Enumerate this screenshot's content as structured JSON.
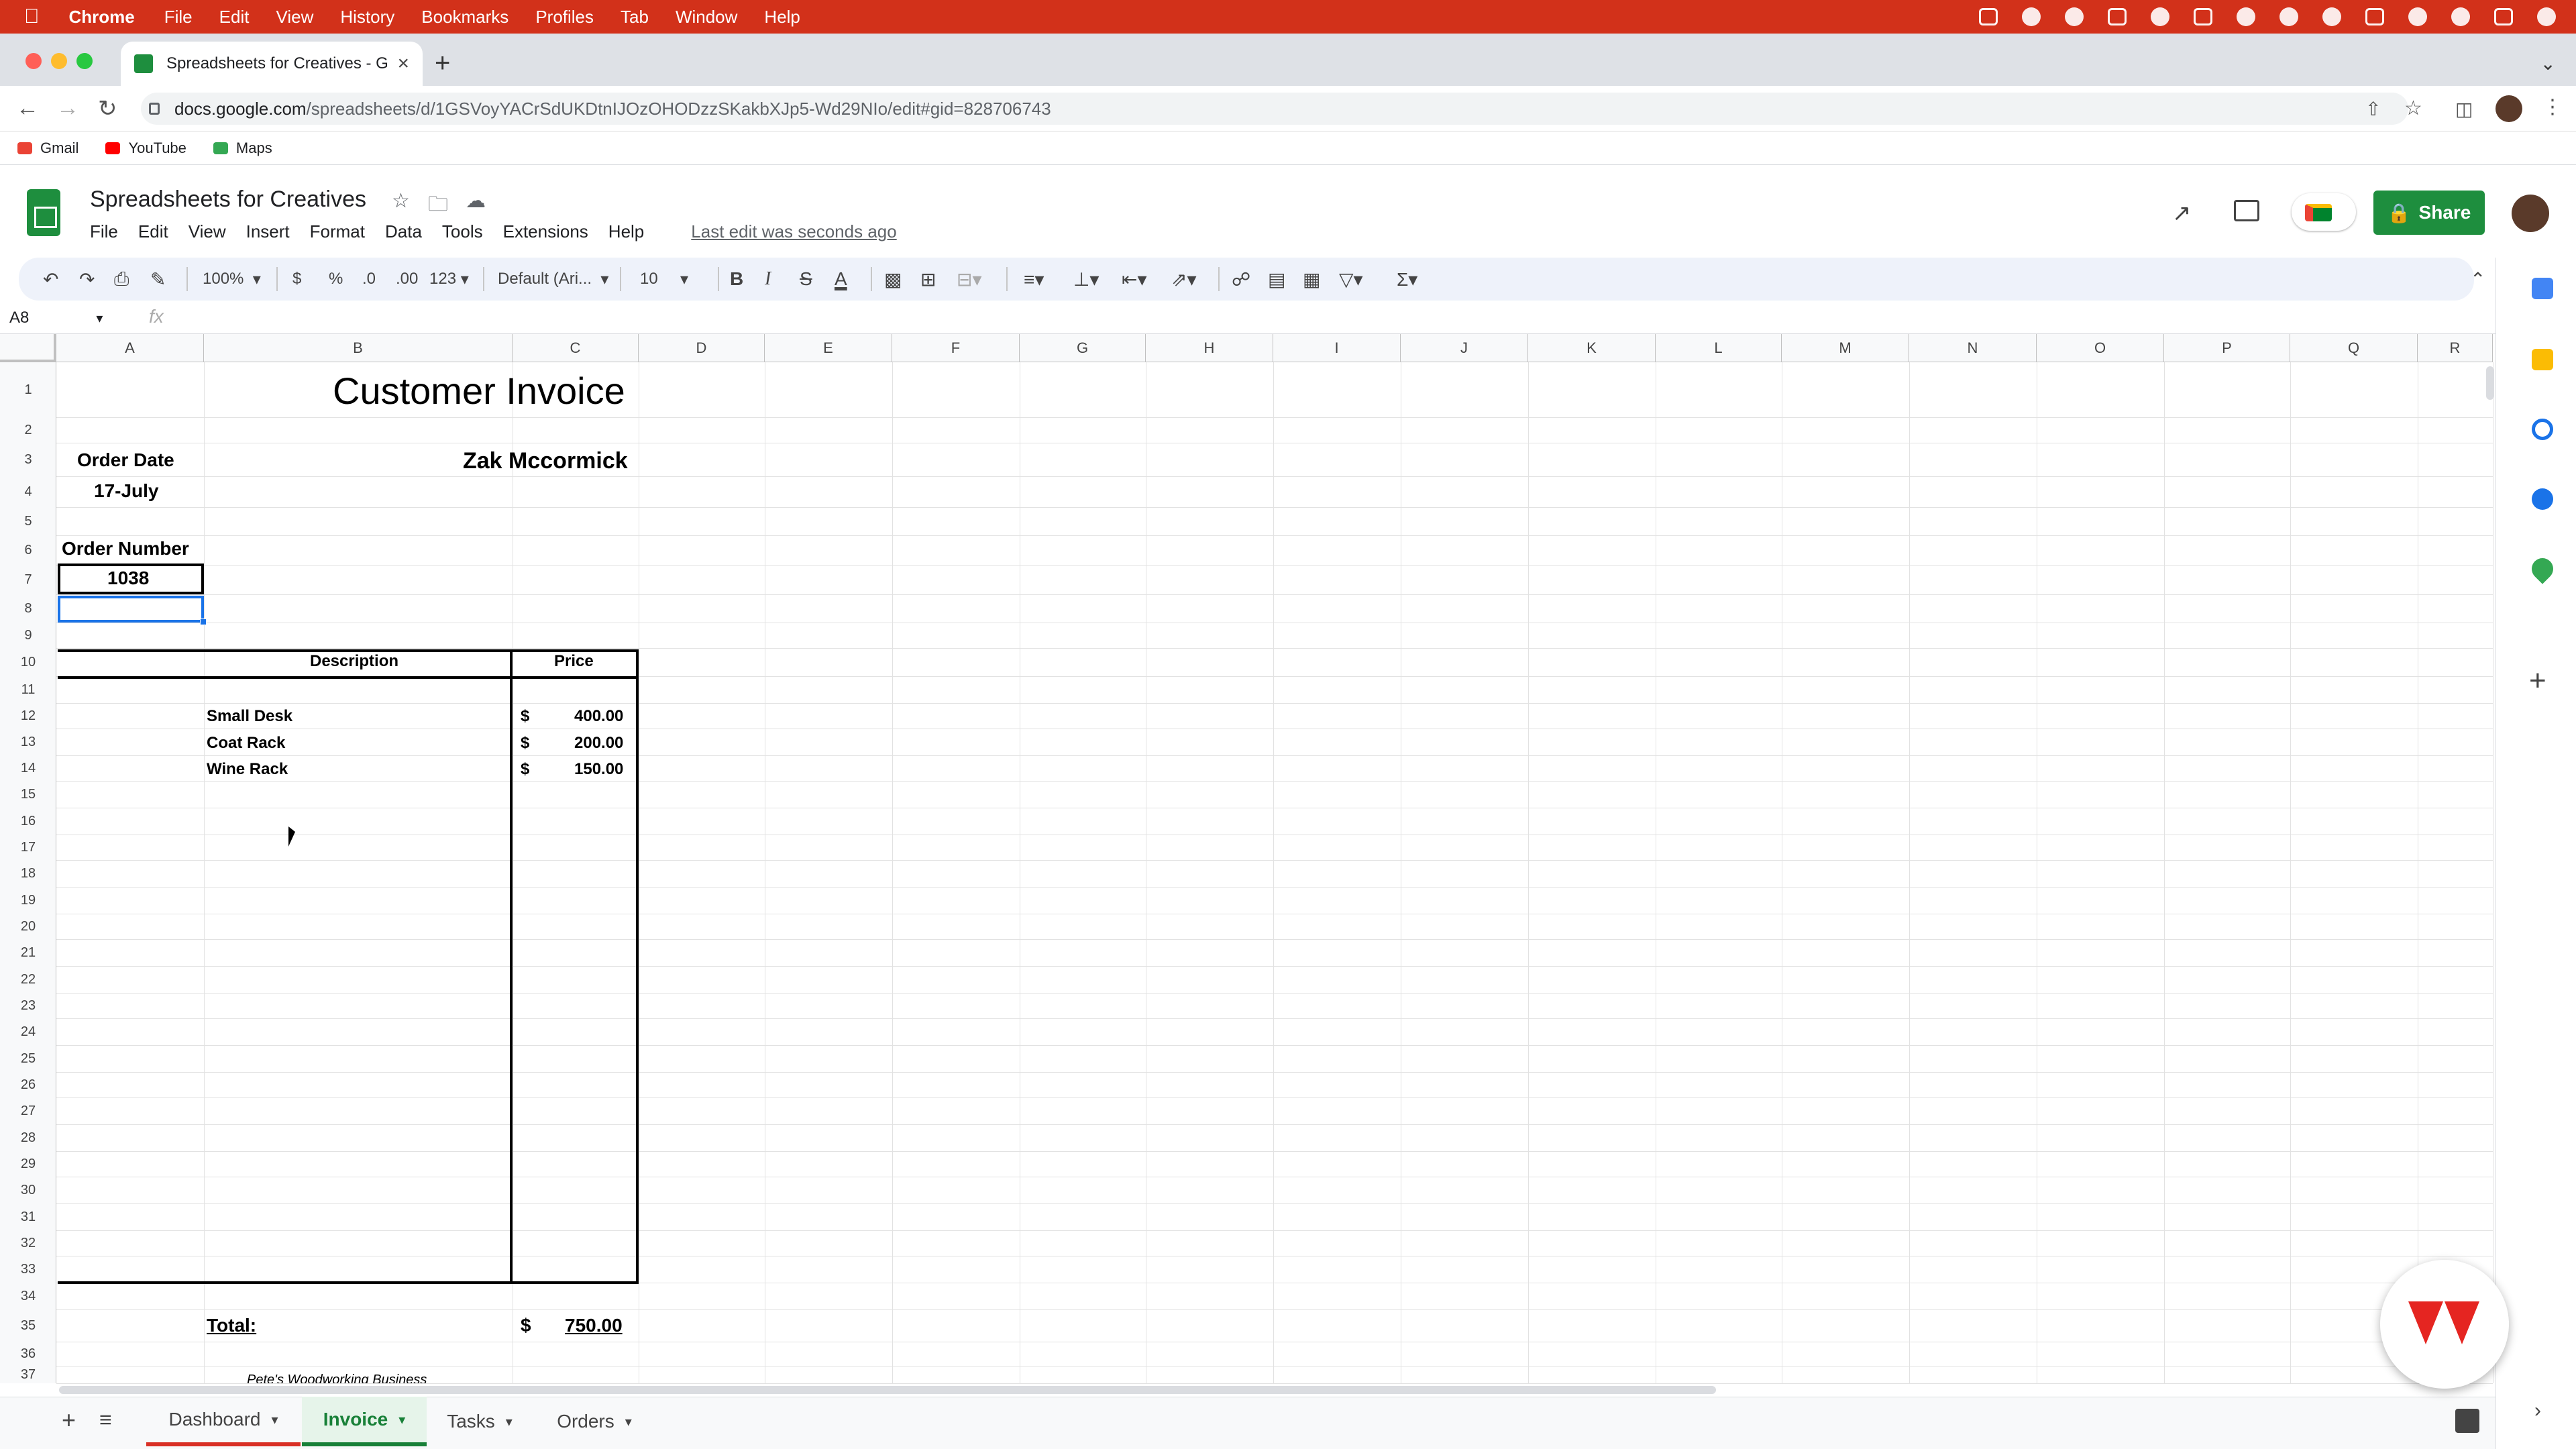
{
  "mac_menubar": {
    "app_name": "Chrome",
    "items": [
      "File",
      "Edit",
      "View",
      "History",
      "Bookmarks",
      "Profiles",
      "Tab",
      "Window",
      "Help"
    ]
  },
  "browser": {
    "tab_title": "Spreadsheets for Creatives - G",
    "url_host": "docs.google.com",
    "url_path": "/spreadsheets/d/1GSVoyYACrSdUKDtnIJOzOHODzzSKakbXJp5-Wd29NIo/edit#gid=828706743",
    "bookmarks": [
      {
        "label": "Gmail",
        "icon": "gmail-icon",
        "color": "#ea4335"
      },
      {
        "label": "YouTube",
        "icon": "youtube-icon",
        "color": "#ff0000"
      },
      {
        "label": "Maps",
        "icon": "maps-icon",
        "color": "#34a853"
      }
    ]
  },
  "sheets": {
    "doc_title": "Spreadsheets for Creatives",
    "menu": [
      "File",
      "Edit",
      "View",
      "Insert",
      "Format",
      "Data",
      "Tools",
      "Extensions",
      "Help"
    ],
    "last_edit": "Last edit was seconds ago",
    "share_label": "Share",
    "toolbar": {
      "zoom": "100%",
      "currency": "$",
      "percent": "%",
      "dec_decrease": ".0",
      "dec_increase": ".00",
      "format_more": "123",
      "font": "Default (Ari...",
      "font_size": "10",
      "bold": "B",
      "italic": "I",
      "strike": "S",
      "text_color": "A"
    },
    "name_box": "A8",
    "fx": "fx"
  },
  "columns": [
    "A",
    "B",
    "C",
    "D",
    "E",
    "F",
    "G",
    "H",
    "I",
    "J",
    "K",
    "L",
    "M",
    "N",
    "O",
    "P",
    "Q",
    "R"
  ],
  "rows": [
    "1",
    "2",
    "3",
    "4",
    "5",
    "6",
    "7",
    "8",
    "9",
    "10",
    "11",
    "12",
    "13",
    "14",
    "15",
    "16",
    "17",
    "18",
    "19",
    "20",
    "21",
    "22",
    "23",
    "24",
    "25",
    "26",
    "27",
    "28",
    "29",
    "30",
    "31",
    "32",
    "33",
    "34",
    "35",
    "36",
    "37"
  ],
  "invoice": {
    "title": "Customer Invoice",
    "order_date_label": "Order Date",
    "order_date": "17-July",
    "customer": "Zak Mccormick",
    "order_number_label": "Order Number",
    "order_number": "1038",
    "desc_header": "Description",
    "price_header": "Price",
    "items": [
      {
        "desc": "Small Desk",
        "currency": "$",
        "price": "400.00"
      },
      {
        "desc": "Coat Rack",
        "currency": "$",
        "price": "200.00"
      },
      {
        "desc": "Wine Rack",
        "currency": "$",
        "price": "150.00"
      }
    ],
    "total_label": "Total:",
    "total_currency": "$",
    "total": "750.00",
    "footer_text": "Pete's Woodworking Business"
  },
  "sheet_tabs": [
    {
      "label": "Dashboard",
      "color": "#d93025"
    },
    {
      "label": "Invoice",
      "color": "#188038"
    },
    {
      "label": "Tasks",
      "color": ""
    },
    {
      "label": "Orders",
      "color": ""
    }
  ],
  "colors": {
    "menubar": "#d2311a",
    "sheets_green": "#1e8e3e",
    "selection_blue": "#1a73e8"
  }
}
